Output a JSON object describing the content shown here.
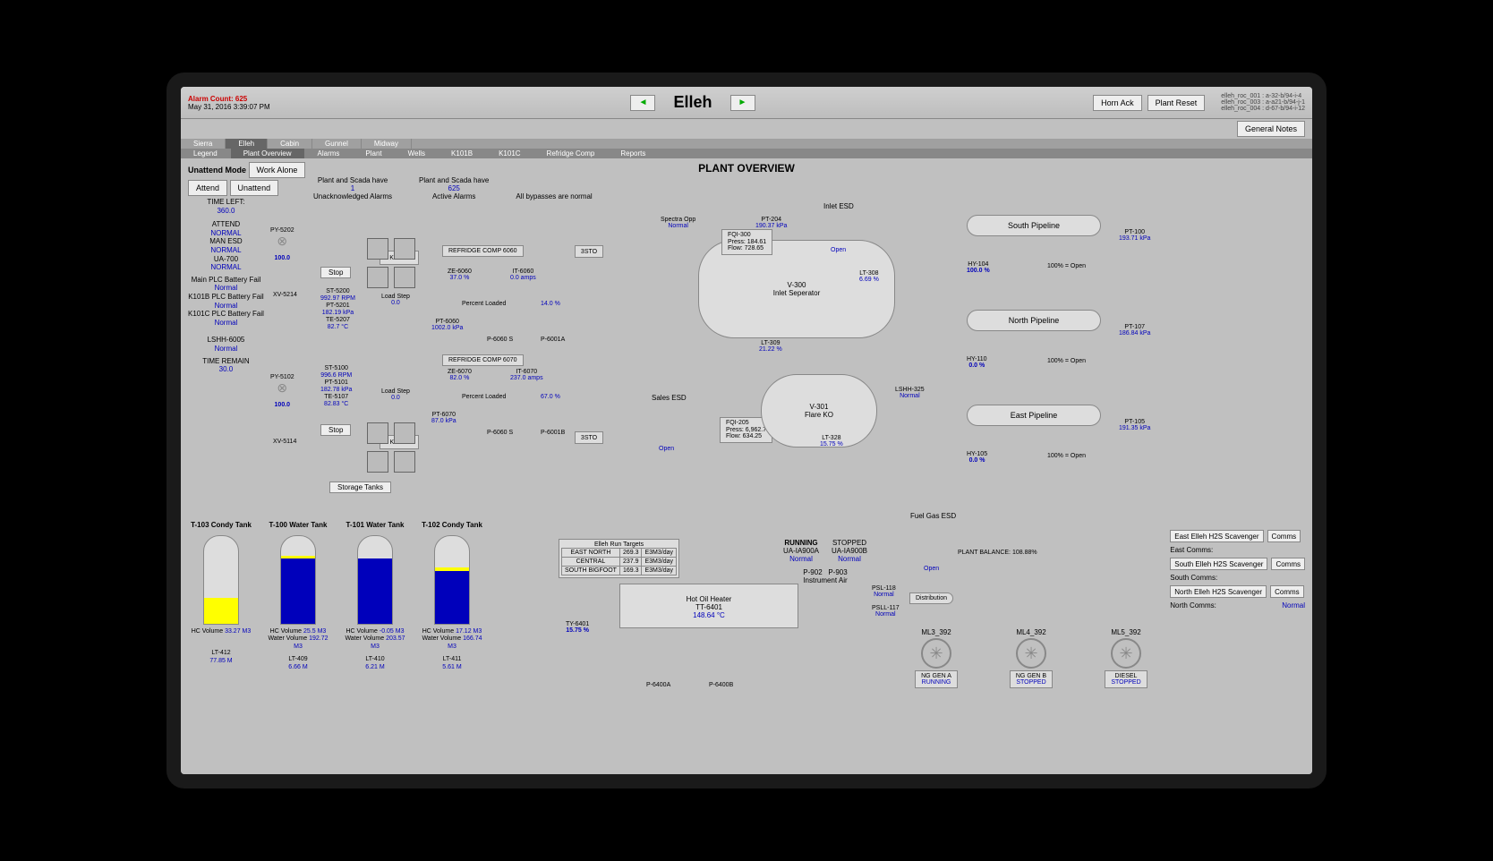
{
  "header": {
    "alarm_count": "Alarm Count: 625",
    "timestamp": "May 31, 2016 3:39:07 PM",
    "title": "Elleh",
    "horn_ack": "Horn Ack",
    "plant_reset": "Plant Reset",
    "general_notes": "General Notes",
    "serials": [
      "elleh_roc_001 : a-32-b/94-i-4",
      "elleh_roc_003 : a-a21-b/94-j-1",
      "elleh_roc_004 : d-67-b/94-i-12"
    ]
  },
  "tabs": {
    "top": [
      "Sierra",
      "Elleh",
      "Cabin",
      "Gunnel",
      "Midway"
    ],
    "sub": [
      "Legend",
      "Plant Overview",
      "Alarms",
      "Plant",
      "Wells",
      "K101B",
      "K101C",
      "Refridge Comp",
      "Reports"
    ]
  },
  "mode": {
    "label": "Unattend Mode",
    "work_alone": "Work Alone",
    "attend": "Attend",
    "unattend": "Unattend"
  },
  "top_info": {
    "unack": {
      "label1": "Plant and Scada have",
      "count": "1",
      "label2": "Unacknowledged Alarms"
    },
    "active": {
      "label1": "Plant and Scada have",
      "count": "625",
      "label2": "Active Alarms"
    },
    "bypass": "All bypasses are normal"
  },
  "page_title": "PLANT OVERVIEW",
  "status": {
    "time_left_lbl": "TIME LEFT:",
    "time_left": "360.0",
    "attend_lbl": "ATTEND",
    "attend": "NORMAL",
    "man_lbl": "MAN ESD",
    "man": "NORMAL",
    "ua_lbl": "UA-700",
    "ua": "NORMAL",
    "plc1_lbl": "Main PLC Battery Fail",
    "plc1": "Normal",
    "plc2_lbl": "K101B PLC Battery Fail",
    "plc2": "Normal",
    "plc3_lbl": "K101C PLC Battery Fail",
    "plc3": "Normal",
    "lshh_lbl": "LSHH-6005",
    "lshh": "Normal",
    "remain_lbl": "TIME REMAIN",
    "remain": "30.0"
  },
  "upper_train": {
    "py": "PY-5202",
    "py_val": "100.0",
    "xv": "XV-5214",
    "stop": "Stop",
    "k": "K101C",
    "refridge": "REFRIDGE COMP 6060",
    "sto": "3STO",
    "data": {
      "st_l": "ST-5200",
      "st_v": "992.97 RPM",
      "pt_l": "PT-5201",
      "pt_v": "182.19 kPa",
      "te_l": "TE-5207",
      "te_v": "82.7 °C"
    },
    "load": "Load Step",
    "load_v": "0.0",
    "ze_l": "ZE-6060",
    "ze_v": "37.0 %",
    "it_l": "IT-6060",
    "it_v": "0.0 amps",
    "pl": "Percent Loaded",
    "pl_v": "14.0 %",
    "pt6_l": "PT-6060",
    "pt6_v": "1002.0 kPa",
    "p1": "P-6060 S",
    "p2": "P-6001A"
  },
  "lower_train": {
    "py": "PY-5102",
    "py_val": "100.0",
    "xv": "XV-5114",
    "stop": "Stop",
    "k": "K101B",
    "refridge": "REFRIDGE COMP 6070",
    "sto": "3STO",
    "data": {
      "st_l": "ST-5100",
      "st_v": "996.6 RPM",
      "pt_l": "PT-5101",
      "pt_v": "182.78 kPa",
      "te_l": "TE-5107",
      "te_v": "82.83 °C"
    },
    "load": "Load Step",
    "load_v": "0.0",
    "ze_l": "ZE-6070",
    "ze_v": "82.0 %",
    "it_l": "IT-6070",
    "it_v": "237.0 amps",
    "pl": "Percent Loaded",
    "pl_v": "67.0 %",
    "pt6_l": "PT-6070",
    "pt6_v": "87.0 kPa",
    "p1": "P-6060 S",
    "p2": "P-6001B"
  },
  "spectra": {
    "lbl": "Spectra Opp",
    "val": "Normal"
  },
  "v300": {
    "name": "V-300",
    "sub": "Inlet Seperator",
    "fqi_lbl": "FQI-300",
    "press": "Press: 184.61",
    "flow": "Flow: 728.65",
    "lt308_l": "LT-308",
    "lt308_v": "6.69 %",
    "lt309_l": "LT-309",
    "lt309_v": "21.22 %",
    "pt204_l": "PT-204",
    "pt204_v": "190.37 kPa",
    "inlet_esd": "Inlet ESD",
    "open": "Open"
  },
  "sales": {
    "lbl": "Sales ESD",
    "open": "Open",
    "fqi_lbl": "FQI-205",
    "press": "Press: 6,962.7",
    "flow": "Flow: 634.25"
  },
  "v301": {
    "name": "V-301",
    "sub": "Flare KO",
    "lt328_l": "LT-328",
    "lt328_v": "15.75 %",
    "lshh_l": "LSHH-325",
    "lshh_v": "Normal"
  },
  "pipelines": {
    "south": {
      "name": "South Pipeline",
      "pt_l": "PT-100",
      "pt_v": "193.71 kPa",
      "hy_l": "HY-104",
      "hy_v": "100.0 %",
      "open": "100% = Open"
    },
    "north": {
      "name": "North Pipeline",
      "pt_l": "PT-107",
      "pt_v": "186.84 kPa",
      "hy_l": "HY-110",
      "hy_v": "0.0 %",
      "open": "100% = Open"
    },
    "east": {
      "name": "East Pipeline",
      "pt_l": "PT-105",
      "pt_v": "191.35 kPa",
      "hy_l": "HY-105",
      "hy_v": "0.0 %",
      "open": "100% = Open"
    }
  },
  "storage_btn": "Storage Tanks",
  "tanks": [
    {
      "name": "T-103 Condy Tank",
      "hc_l": "HC Volume",
      "hc_v": "33.27 M3",
      "lt_l": "LT-412",
      "lt_v": "77.85 M",
      "yellow": 30,
      "blue": 0
    },
    {
      "name": "T-100 Water Tank",
      "hc_l": "HC Volume",
      "hc_v": "25.5 M3",
      "wv_l": "Water Volume",
      "wv_v": "192.72 M3",
      "lt_l": "LT-409",
      "lt_v": "6.66 M",
      "yellow": 4,
      "blue": 74
    },
    {
      "name": "T-101 Water Tank",
      "hc_l": "HC Volume",
      "hc_v": "-0.05 M3",
      "wv_l": "Water Volume",
      "wv_v": "203.57 M3",
      "lt_l": "LT-410",
      "lt_v": "6.21 M",
      "yellow": 0,
      "blue": 75
    },
    {
      "name": "T-102 Condy Tank",
      "hc_l": "HC Volume",
      "hc_v": "17.12 M3",
      "wv_l": "Water Volume",
      "wv_v": "166.74 M3",
      "lt_l": "LT-411",
      "lt_v": "5.61 M",
      "yellow": 4,
      "blue": 60
    }
  ],
  "run_targets": {
    "title": "Elleh Run Targets",
    "rows": [
      [
        "EAST NORTH",
        "269.3",
        "E3M3/day"
      ],
      [
        "CENTRAL",
        "237.9",
        "E3M3/day"
      ],
      [
        "SOUTH BIGFOOT",
        "169.3",
        "E3M3/day"
      ]
    ]
  },
  "heater": {
    "name": "Hot Oil Heater",
    "ty_l": "TY-6401",
    "ty_v": "15.75 %",
    "tt_l": "TT-6401",
    "tt_v": "148.64 °C",
    "p1": "P-6400A",
    "p2": "P-6400B"
  },
  "ia": {
    "running": "RUNNING",
    "stopped": "STOPPED",
    "ua_a_l": "UA-IA900A",
    "ua_a_v": "Normal",
    "ua_b_l": "UA-IA900B",
    "ua_b_v": "Normal",
    "p1": "P-902",
    "p2": "P-903",
    "name": "Instrument Air",
    "psl_l": "PSL-118",
    "psl_v": "Normal",
    "psll_l": "PSLL-117",
    "psll_v": "Normal",
    "dist": "Distribution"
  },
  "fuel_esd": {
    "lbl": "Fuel Gas ESD",
    "open": "Open"
  },
  "balance": "PLANT BALANCE: 108.88%",
  "scavenger": {
    "east": "East Elleh H2S Scavenger",
    "south": "South Elleh H2S Scavenger",
    "north": "North Elleh H2S Scavenger",
    "comms": "Comms",
    "east_c": "East Comms:",
    "south_c": "South Comms:",
    "north_c": "North Comms:",
    "normal": "Normal"
  },
  "gens": [
    {
      "name": "ML3_392",
      "gen": "NG GEN A",
      "state": "RUNNING"
    },
    {
      "name": "ML4_392",
      "gen": "NG GEN B",
      "state": "STOPPED"
    },
    {
      "name": "ML5_392",
      "gen": "DIESEL",
      "state": "STOPPED"
    }
  ]
}
